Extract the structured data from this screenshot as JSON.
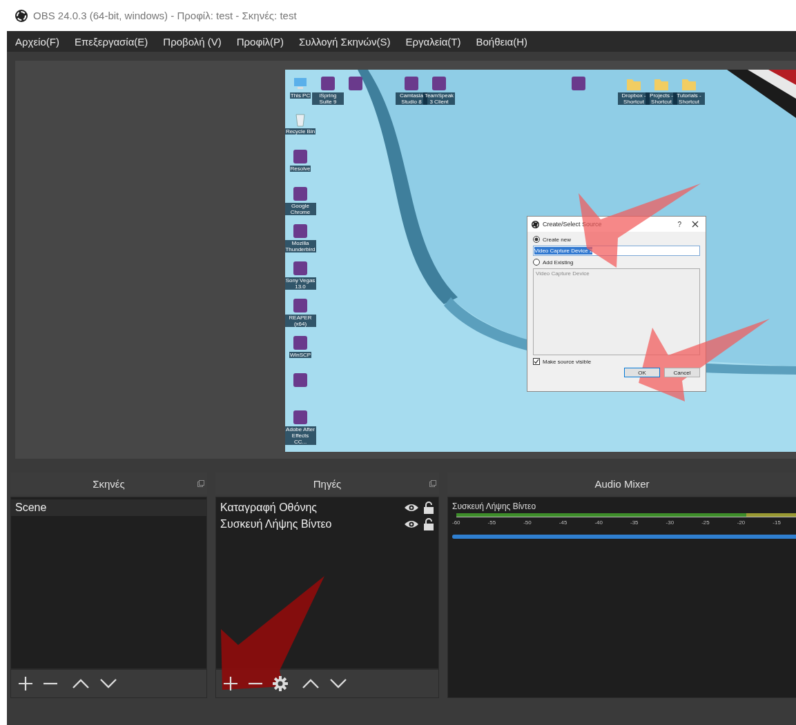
{
  "window": {
    "title": "OBS 24.0.3 (64-bit, windows) - Προφίλ: test - Σκηνές: test"
  },
  "menu": [
    "Αρχείο(F)",
    "Επεξεργασία(E)",
    "Προβολή (V)",
    "Προφίλ(P)",
    "Συλλογή Σκηνών(S)",
    "Εργαλεία(T)",
    "Βοήθεια(H)"
  ],
  "preview": {
    "desktop_icons": [
      {
        "label": "This PC",
        "kind": "pc"
      },
      {
        "label": "iSpring Suite 9",
        "kind": "app"
      },
      {
        "kind": "app"
      },
      {
        "label": "Camtasia Studio 8",
        "kind": "app"
      },
      {
        "label": "TeamSpeak 3 Client",
        "kind": "app"
      },
      {
        "kind": "app"
      },
      {
        "label": "Dropbox - Shortcut",
        "kind": "folder"
      },
      {
        "label": "Projects - Shortcut",
        "kind": "folder"
      },
      {
        "label": "Tutorials - Shortcut",
        "kind": "folder"
      },
      {
        "label": "Recycle Bin",
        "kind": "bin"
      },
      {
        "label": "Resolve",
        "kind": "app"
      },
      {
        "label": "Google Chrome",
        "kind": "app"
      },
      {
        "label": "Mozilla Thunderbird",
        "kind": "app"
      },
      {
        "label": "Sony Vegas 13.0",
        "kind": "app"
      },
      {
        "label": "REAPER (x64)",
        "kind": "app"
      },
      {
        "label": "WinSCP",
        "kind": "app"
      },
      {
        "kind": "app"
      },
      {
        "label": "Adobe After Effects CC...",
        "kind": "app"
      }
    ],
    "dialog": {
      "title": "Create/Select Source",
      "help": "?",
      "options": [
        {
          "label": "Create new",
          "selected": true
        },
        {
          "label": "Add Existing",
          "selected": false
        }
      ],
      "name_value": "Video Capture Device 2",
      "existing": [
        "Video Capture Device"
      ],
      "make_visible": {
        "label": "Make source visible",
        "checked": true
      },
      "buttons": [
        {
          "label": "OK",
          "default": true
        },
        {
          "label": "Cancel",
          "default": false
        }
      ]
    }
  },
  "scenes": {
    "title": "Σκηνές",
    "items": [
      {
        "label": "Scene",
        "selected": true
      }
    ]
  },
  "sources": {
    "title": "Πηγές",
    "items": [
      {
        "label": "Καταγραφή Οθόνης",
        "visible": true
      },
      {
        "label": "Συσκευή Λήψης Βίντεο",
        "visible": true
      }
    ]
  },
  "audio_mixer": {
    "title": "Audio Mixer",
    "channels": [
      {
        "name": "Συσκευή Λήψης Βίντεο",
        "scale": [
          "-60",
          "-55",
          "-50",
          "-45",
          "-40",
          "-35",
          "-30",
          "-25",
          "-20",
          "-15"
        ],
        "level": 1
      }
    ]
  },
  "annotations": [
    {
      "kind": "light"
    },
    {
      "kind": "light"
    },
    {
      "kind": "dark"
    }
  ]
}
